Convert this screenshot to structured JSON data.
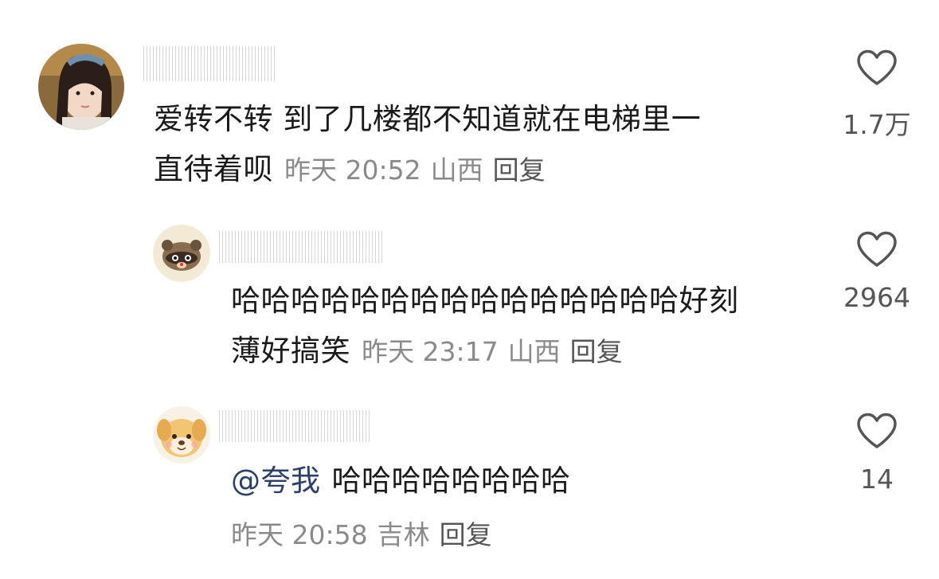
{
  "comments": [
    {
      "username": "",
      "text": "爱转不转 到了几楼都不知道就在电梯里一直待着呗",
      "text_line1": "爱转不转 到了几楼都不知道就在电梯里一",
      "text_line2": "直待着呗",
      "time": "昨天 20:52",
      "region": "山西",
      "reply_label": "回复",
      "likes": "1.7万"
    },
    {
      "username": "",
      "text_line1": "哈哈哈哈哈哈哈哈哈哈哈哈哈哈哈好刻",
      "text_line2": "薄好搞笑",
      "time": "昨天 23:17",
      "region": "山西",
      "reply_label": "回复",
      "likes": "2964"
    },
    {
      "username": "",
      "mention": "@夸我",
      "text": "哈哈哈哈哈哈哈哈",
      "time": "昨天 20:58",
      "region": "吉林",
      "reply_label": "回复",
      "likes": "14"
    }
  ],
  "icons": {
    "like": "heart-outline-icon",
    "avatar1": "girl-photo-avatar",
    "avatar2": "raccoon-avatar",
    "avatar3": "plush-dog-avatar"
  },
  "colors": {
    "text": "#1a1a1a",
    "meta": "#8a8a8a",
    "mention": "#2a3f6a",
    "icon": "#555555"
  }
}
